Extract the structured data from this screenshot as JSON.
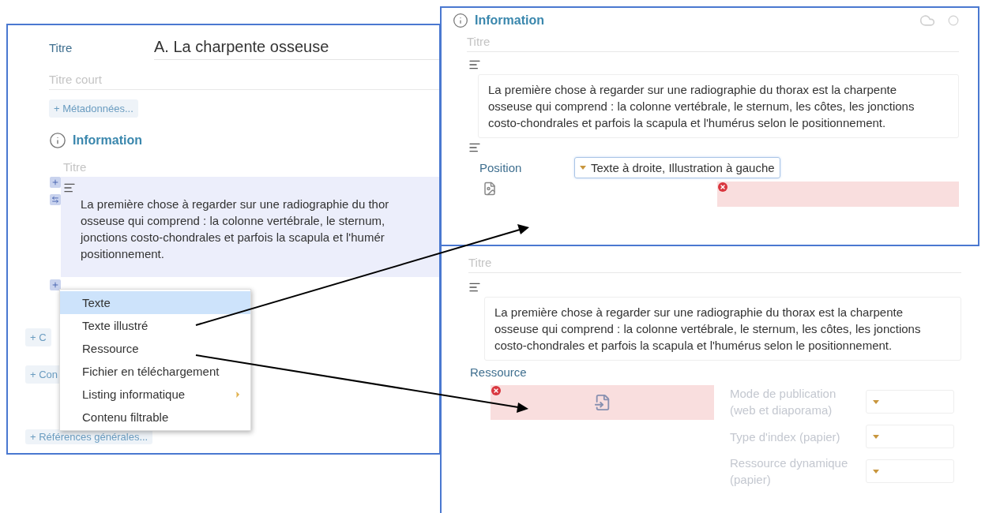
{
  "editor": {
    "title_label": "Titre",
    "title_value": "A. La charpente osseuse",
    "short_title_placeholder": "Titre court",
    "metadata_button": "+ Métadonnées...",
    "section": {
      "heading": "Information",
      "title_placeholder": "Titre",
      "paragraph_lines": [
        "La première chose à regarder sur une radiographie du thor",
        "osseuse qui comprend : la colonne vertébrale, le sternum,",
        "jonctions costo-chondrales et parfois la scapula et l'humér",
        "positionnement."
      ]
    },
    "add_buttons": [
      "+ C",
      "+ Con",
      "+ Références générales..."
    ]
  },
  "insert_menu": {
    "items": [
      {
        "label": "Texte",
        "selected": true,
        "submenu": false
      },
      {
        "label": "Texte illustré",
        "selected": false,
        "submenu": false
      },
      {
        "label": "Ressource",
        "selected": false,
        "submenu": false
      },
      {
        "label": "Fichier en téléchargement",
        "selected": false,
        "submenu": false
      },
      {
        "label": "Listing informatique",
        "selected": false,
        "submenu": true
      },
      {
        "label": "Contenu filtrable",
        "selected": false,
        "submenu": false
      }
    ]
  },
  "illustrated_text_block": {
    "heading": "Information",
    "title_placeholder": "Titre",
    "paragraph": "La première chose à regarder sur une radiographie du thorax est la charpente osseuse qui comprend : la colonne vertébrale, le sternum, les côtes, les jonctions costo-chondrales et parfois la scapula et l'humérus selon le positionnement.",
    "position_label": "Position",
    "position_value": "Texte à droite, Illustration à gauche"
  },
  "resource_block": {
    "title_placeholder": "Titre",
    "paragraph": "La première chose à regarder sur une radiographie du thorax est la charpente osseuse qui comprend : la colonne vertébrale, le sternum, les côtes, les jonctions costo-chondrales et parfois la scapula et l'humérus selon le positionnement.",
    "heading": "Ressource",
    "options": [
      {
        "label": "Mode de publication (web et diaporama)"
      },
      {
        "label": "Type d'index (papier)"
      },
      {
        "label": "Ressource dynamique (papier)"
      }
    ]
  }
}
